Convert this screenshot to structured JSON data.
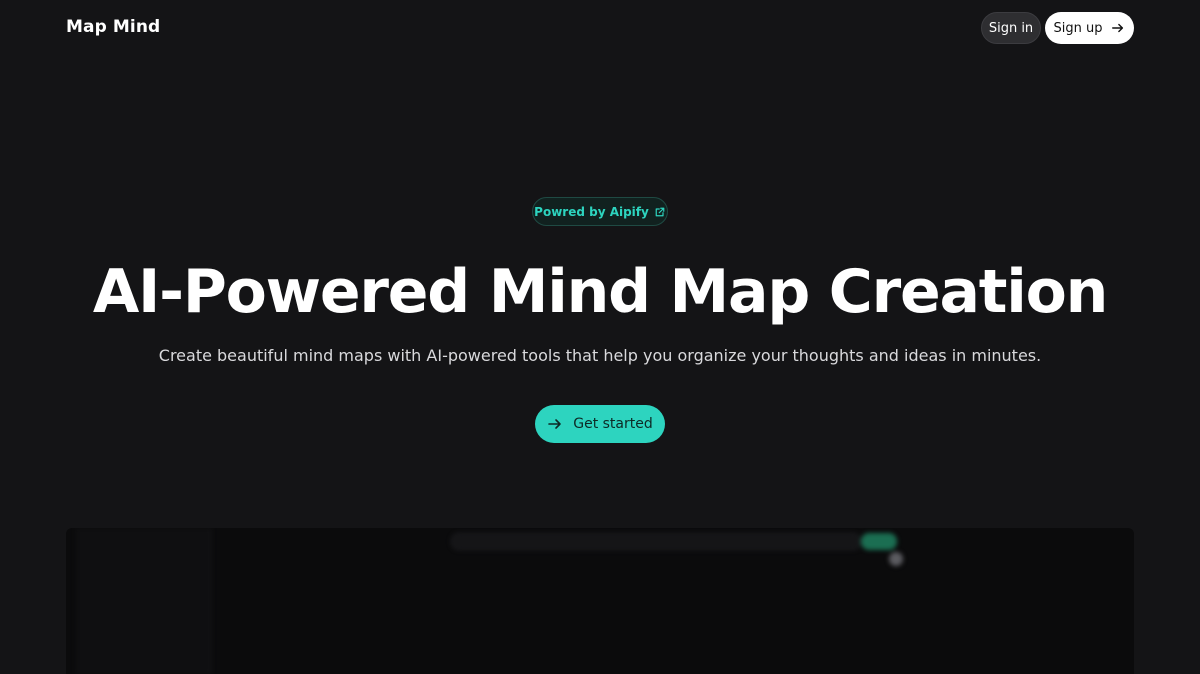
{
  "header": {
    "brand": "Map Mind",
    "sign_in_label": "Sign in",
    "sign_up_label": "Sign up"
  },
  "hero": {
    "badge_label": "Powred by Aipify",
    "title": "AI-Powered Mind Map Creation",
    "subtitle": "Create beautiful mind maps with AI-powered tools that help you organize your thoughts and ideas in minutes.",
    "cta_label": "Get started"
  },
  "icons": {
    "sign_up": "arrow-right-icon",
    "badge": "external-link-icon",
    "cta": "arrow-right-icon"
  },
  "colors": {
    "background": "#141416",
    "accent": "#2dd4bf",
    "badge_bg": "#11211f"
  }
}
